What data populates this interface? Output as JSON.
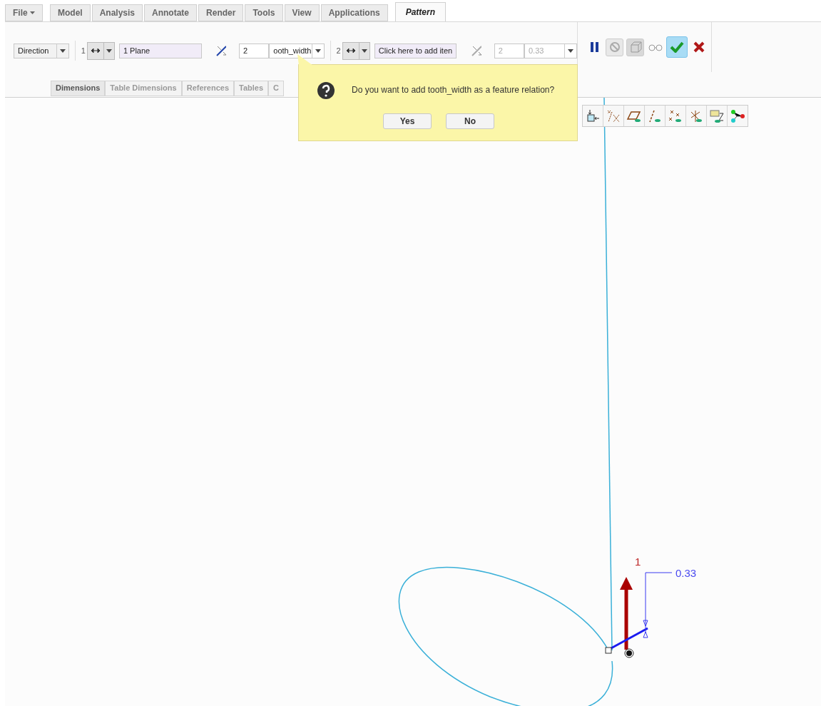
{
  "ribbon_tabs": [
    {
      "label": "File",
      "kind": "menu",
      "selected": false
    },
    {
      "label": "Model",
      "kind": "tab",
      "selected": false
    },
    {
      "label": "Analysis",
      "kind": "tab",
      "selected": false
    },
    {
      "label": "Annotate",
      "kind": "tab",
      "selected": false
    },
    {
      "label": "Render",
      "kind": "tab",
      "selected": false
    },
    {
      "label": "Tools",
      "kind": "tab",
      "selected": false
    },
    {
      "label": "View",
      "kind": "tab",
      "selected": false
    },
    {
      "label": "Applications",
      "kind": "tab",
      "selected": false
    },
    {
      "label": "Pattern",
      "kind": "tab",
      "selected": true
    }
  ],
  "pattern_bar": {
    "type_dropdown": "Direction",
    "direction_1": {
      "number": "1",
      "reference": "1 Plane",
      "count": "2",
      "spacing": "ooth_width",
      "disabled": false
    },
    "direction_2": {
      "number": "2",
      "reference": "Click here to add iten",
      "count": "2",
      "spacing": "0.33",
      "disabled": true
    }
  },
  "sub_tabs": [
    {
      "label": "Dimensions",
      "selected": true
    },
    {
      "label": "Table Dimensions",
      "selected": false
    },
    {
      "label": "References",
      "selected": false
    },
    {
      "label": "Tables",
      "selected": false
    },
    {
      "label": "C",
      "selected": false
    }
  ],
  "dialog": {
    "message": "Do you want to add tooth_width as a feature relation?",
    "buttons": [
      "Yes",
      "No"
    ]
  },
  "canvas": {
    "direction_label": "1",
    "dimension_label": "0.33"
  }
}
